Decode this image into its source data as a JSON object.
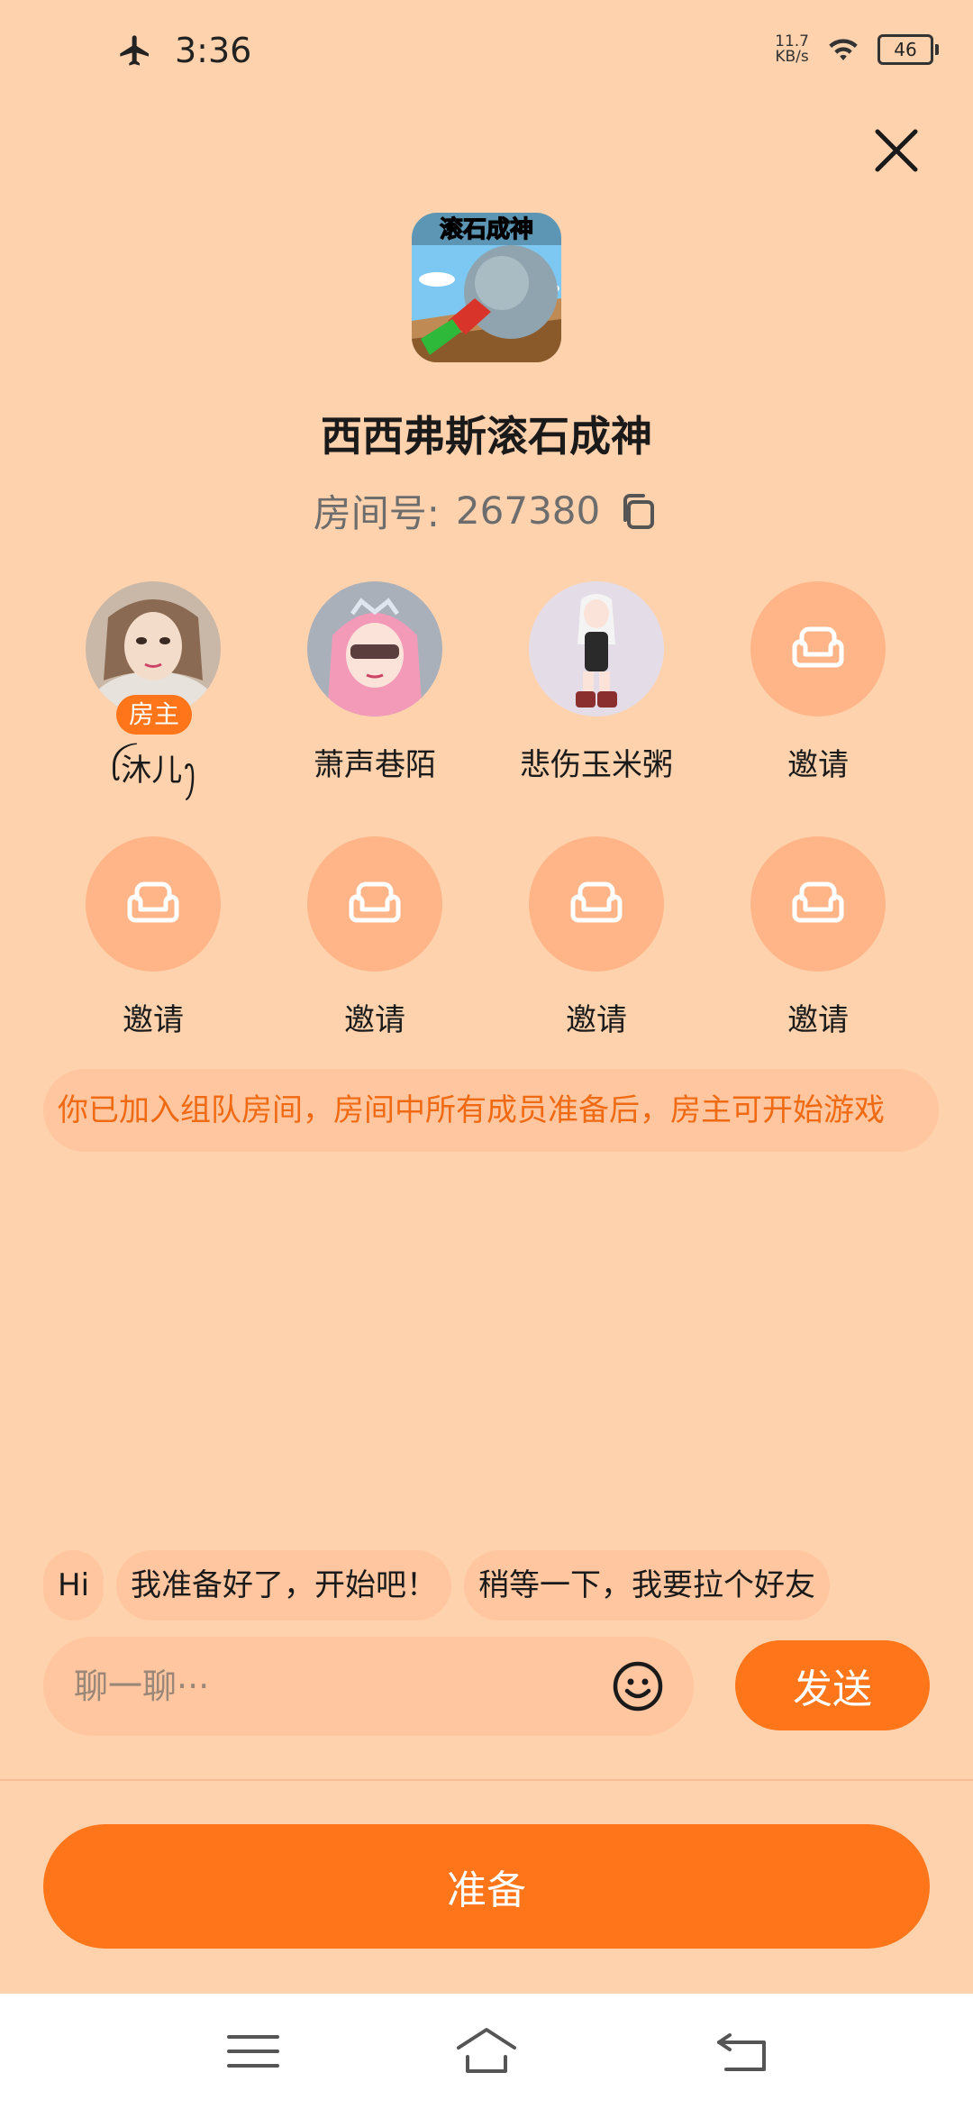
{
  "status_bar": {
    "time": "3:36",
    "net_speed_value": "11.7",
    "net_speed_unit": "KB/s",
    "battery": "46"
  },
  "game": {
    "title": "西西弗斯滚石成神",
    "icon_text": "滚石成神",
    "room_label": "房间号:",
    "room_number": "267380"
  },
  "members": [
    {
      "name": "ꪶ沐儿ꫂ",
      "badge": "房主"
    },
    {
      "name": "萧声巷陌"
    },
    {
      "name": "悲伤玉米粥"
    }
  ],
  "invite_label": "邀请",
  "notice": "你已加入组队房间，房间中所有成员准备后，房主可开始游戏",
  "quick_replies": [
    "Hi",
    "我准备好了，开始吧！",
    "稍等一下，我要拉个好友"
  ],
  "chat": {
    "placeholder": "聊一聊···",
    "send_label": "发送"
  },
  "ready_label": "准备",
  "colors": {
    "background": "#FFD2AE",
    "accent": "#FF7519",
    "notice_text": "#F06A13",
    "invite_circle": "#FFB587"
  },
  "icons": [
    "airplane-icon",
    "wifi-icon",
    "battery-icon",
    "close-icon",
    "copy-icon",
    "sofa-icon",
    "emoji-icon",
    "menu-icon",
    "home-icon",
    "back-icon"
  ]
}
